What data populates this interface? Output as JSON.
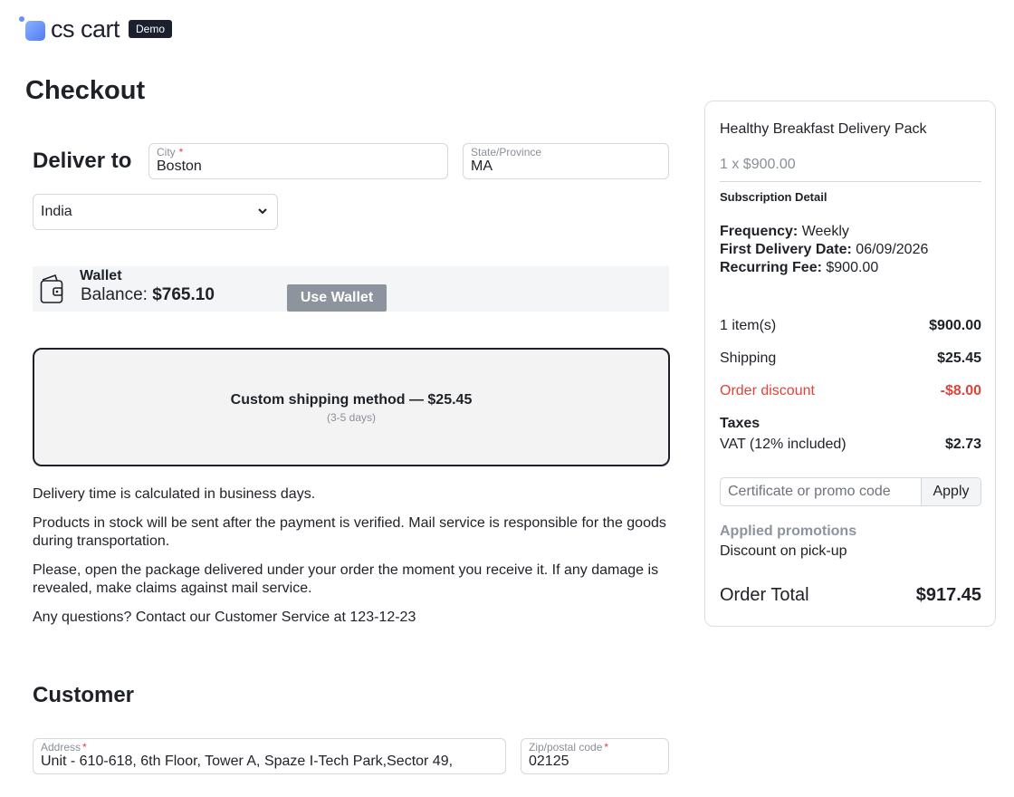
{
  "brand": {
    "logo_text": "cs cart",
    "badge": "Demo"
  },
  "page_title": "Checkout",
  "deliver": {
    "heading": "Deliver to",
    "city": {
      "label": "City",
      "required": "*",
      "value": "Boston"
    },
    "state": {
      "label": "State/Province",
      "value": "MA"
    },
    "country": {
      "value": "India"
    }
  },
  "wallet": {
    "title": "Wallet",
    "balance_label": "Balance:",
    "balance_value": "$765.10",
    "button": "Use Wallet"
  },
  "shipping": {
    "name": "Custom shipping method — $25.45",
    "days": "(3-5 days)"
  },
  "info_lines": [
    "Delivery time is calculated in business days.",
    "Products in stock will be sent after the payment is verified. Mail service is responsible for the goods during transportation.",
    "Please, open the package delivered under your order the moment you receive it. If any damage is revealed, make claims against mail service.",
    "Any questions? Contact our Customer Service at 123-12-23"
  ],
  "customer": {
    "heading": "Customer",
    "address": {
      "label": "Address",
      "required": "*",
      "value": "Unit - 610-618, 6th Floor, Tower A, Spaze I-Tech Park,Sector 49,"
    },
    "zip": {
      "label": "Zip/postal code",
      "required": "*",
      "value": "02125"
    }
  },
  "summary": {
    "product_name": "Healthy Breakfast Delivery Pack",
    "product_qty": "1 x $900.00",
    "subscription_heading": "Subscription Detail",
    "frequency_label": "Frequency:",
    "frequency_value": "Weekly",
    "first_delivery_label": "First Delivery Date:",
    "first_delivery_value": "06/09/2026",
    "recurring_label": "Recurring Fee:",
    "recurring_value": "$900.00",
    "items_label": "1 item(s)",
    "items_value": "$900.00",
    "shipping_label": "Shipping",
    "shipping_value": "$25.45",
    "discount_label": "Order discount",
    "discount_value": "-$8.00",
    "taxes_heading": "Taxes",
    "vat_label": "VAT (12% included)",
    "vat_value": "$2.73",
    "promo_placeholder": "Certificate or promo code",
    "promo_button": "Apply",
    "applied_heading": "Applied promotions",
    "applied_item": "Discount on pick-up",
    "total_label": "Order Total",
    "total_value": "$917.45"
  },
  "colors": {
    "accent_red": "#e0433a",
    "muted_button": "#8d949d",
    "logo_blue": "#4f7df3"
  }
}
